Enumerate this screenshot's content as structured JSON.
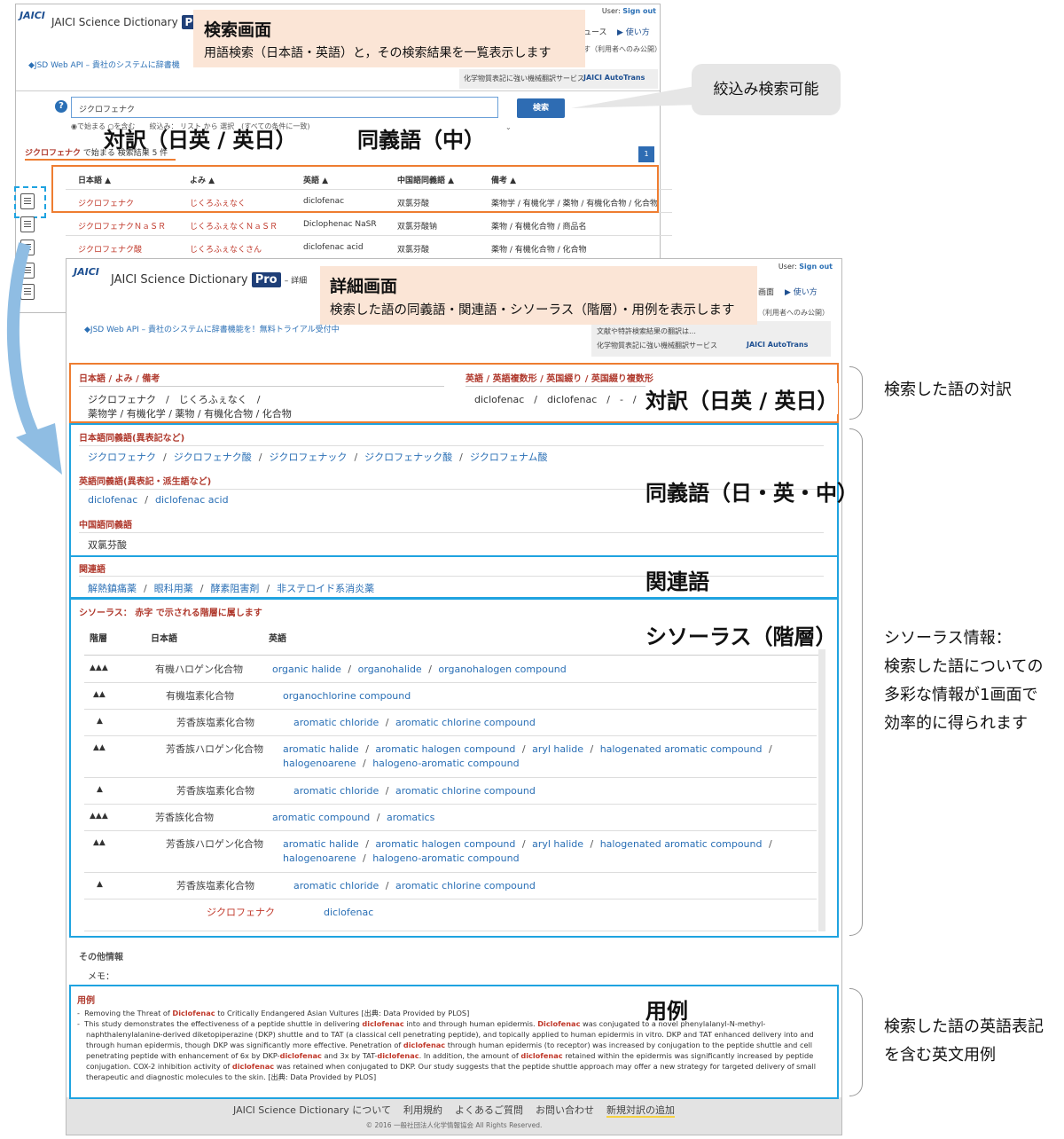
{
  "search": {
    "logo": "JAICI",
    "app_title": "JAICI Science Dictionary",
    "pro": "Pro",
    "user_label": "User:",
    "sign_out": "Sign out",
    "nav_news": "ュース",
    "nav_howto": "▶ 使い方",
    "nav_public": "す（利用者へのみ公開）",
    "api_link": "◆JSD Web API – 貴社のシステムに辞書機",
    "autotrans_text": "化学物質表記に強い機械翻訳サービス",
    "autotrans_brand": "JAICI AutoTrans",
    "help": "?",
    "query": "ジクロフェナク",
    "search_button": "検索",
    "options": "◉で始まる ○を含む　　絞込み： リスト から 選択　(すべての条件に一致)",
    "result_query": "ジクロフェナク",
    "result_text": " で始まる 検索結果 5 件",
    "page": "1",
    "columns": [
      "日本語 ▲",
      "よみ ▲",
      "英語 ▲",
      "中国語同義語 ▲",
      "備考 ▲"
    ],
    "rows": [
      [
        "ジクロフェナク",
        "じくろふぇなく",
        "diclofenac",
        "双氯芬酸",
        "薬物学 / 有機化学 / 薬物 / 有機化合物 / 化合物"
      ],
      [
        "ジクロフェナクＮａＳＲ",
        "じくろふぇなくＮａＳＲ",
        "Diclophenac NaSR",
        "双氯芬酸钠",
        "薬物 / 有機化合物 / 商品名"
      ],
      [
        "ジクロフェナク酸",
        "じくろふぇなくさん",
        "diclofenac acid",
        "双氯芬酸",
        "薬物 / 有機化合物 / 化合物"
      ]
    ]
  },
  "callouts": {
    "search_title": "検索画面",
    "search_desc": "用語検索（日本語・英語）と，その検索結果を一覧表示します",
    "narrow": "絞込み検索可能",
    "trans_label": "対訳（日英 / 英日）",
    "syn_mid_label": "同義語（中）",
    "detail_title": "詳細画面",
    "detail_desc": "検索した語の同義語・関連語・シソーラス（階層）・用例を表示します",
    "trans_label2": "対訳（日英 / 英日）",
    "syn_label": "同義語（日・英・中）",
    "rel_label": "関連語",
    "thes_label": "シソーラス（階層）",
    "ex_label": "用例"
  },
  "annotations": {
    "trans": "検索した語の対訳",
    "thes_lines": [
      "シソーラス情報：",
      "検索した語についての",
      "多彩な情報が1画面で",
      "効率的に得られます"
    ],
    "ex_lines": [
      "検索した語の英語表記",
      "を含む英文用例"
    ]
  },
  "detail": {
    "logo": "JAICI",
    "app_title": "JAICI Science Dictionary",
    "pro": "Pro",
    "crumb": "– 詳細",
    "user_label": "User:",
    "sign_out": "Sign out",
    "nav_screen": "画面",
    "nav_howto": "▶ 使い方",
    "nav_public": "（利用者へのみ公開）",
    "api_link": "◆JSD Web API – 貴社のシステムに辞書機能を！無料トライアル受付中",
    "promo_line1": "文献や特許検索結果の翻訳は…",
    "promo_line2": "化学物質表記に強い機械翻訳サービス",
    "autotrans_brand": "JAICI AutoTrans",
    "trans_ja_head": "日本語 / よみ / 備考",
    "trans_en_head": "英語 / 英語複数形 / 英国綴り / 英国綴り複数形",
    "trans_ja_line1": "ジクロフェナク　/　じくろふぇなく　/",
    "trans_ja_line2": "薬物学 / 有機化学 / 薬物 / 有機化合物 / 化合物",
    "trans_en_line": "diclofenac　/　diclofenac　/　-　/　-",
    "jp_syn_head": "日本語同義語(異表記など)",
    "jp_syn": [
      "ジクロフェナク",
      "ジクロフェナク酸",
      "ジクロフェナック",
      "ジクロフェナック酸",
      "ジクロフェナム酸"
    ],
    "en_syn_head": "英語同義語(異表記・派生語など)",
    "en_syn": [
      "diclofenac",
      "diclofenac acid"
    ],
    "cn_syn_head": "中国語同義語",
    "cn_syn": [
      "双氯芬酸"
    ],
    "rel_head": "関連語",
    "related": [
      "解熱鎮痛薬",
      "眼科用薬",
      "酵素阻害剤",
      "非ステロイド系消炎薬"
    ],
    "thes_head": "シソーラス：",
    "thes_head_red": "赤字",
    "thes_head_rest": "で示される階層に属します",
    "thes_col_level": "階層",
    "thes_col_ja": "日本語",
    "thes_col_en": "英語",
    "thes_rows": [
      {
        "level": "▲▲▲",
        "ja": "有機ハロゲン化合物",
        "en": [
          "organic halide",
          "organohalide",
          "organohalogen compound"
        ]
      },
      {
        "level": "▲▲",
        "ja": "有機塩素化合物",
        "en": [
          "organochlorine compound"
        ]
      },
      {
        "level": "▲",
        "ja": "芳香族塩素化合物",
        "en": [
          "aromatic chloride",
          "aromatic chlorine compound"
        ]
      },
      {
        "level": "▲▲",
        "ja": "芳香族ハロゲン化合物",
        "en": [
          "aromatic halide",
          "aromatic halogen compound",
          "aryl halide",
          "halogenated aromatic compound",
          "halogenoarene",
          "halogeno-aromatic compound"
        ]
      },
      {
        "level": "▲",
        "ja": "芳香族塩素化合物",
        "en": [
          "aromatic chloride",
          "aromatic chlorine compound"
        ]
      },
      {
        "level": "▲▲▲",
        "ja": "芳香族化合物",
        "en": [
          "aromatic compound",
          "aromatics"
        ]
      },
      {
        "level": "▲▲",
        "ja": "芳香族ハロゲン化合物",
        "en": [
          "aromatic halide",
          "aromatic halogen compound",
          "aryl halide",
          "halogenated aromatic compound",
          "halogenoarene",
          "halogeno-aromatic compound"
        ]
      },
      {
        "level": "▲",
        "ja": "芳香族塩素化合物",
        "en": [
          "aromatic chloride",
          "aromatic chlorine compound"
        ]
      },
      {
        "level": "",
        "ja": "ジクロフェナク",
        "en": [
          "diclofenac"
        ]
      }
    ],
    "other_head": "その他情報",
    "memo": "メモ：",
    "ex_head": "用例",
    "example1": "Removing the Threat of Diclofenac to Critically Endangered Asian Vultures [出典: Data Provided by PLOS]",
    "example2": "This study demonstrates the effectiveness of a peptide shuttle in delivering diclofenac into and through human epidermis. Diclofenac was conjugated to a novel phenylalanyl-N-methyl-naphthalenylalanine-derived diketopiperazine (DKP) shuttle and to TAT (a classical cell penetrating peptide), and topically applied to human epidermis in vitro. DKP and TAT enhanced delivery into and through human epidermis, though DKP was significantly more effective. Penetration of diclofenac through human epidermis (to receptor) was increased by conjugation to the peptide shuttle and cell penetrating peptide with enhancement of 6x by DKP-diclofenac and 3x by TAT-diclofenac. In addition, the amount of diclofenac retained within the epidermis was significantly increased by peptide conjugation. COX-2 inhibition activity of diclofenac was retained when conjugated to DKP. Our study suggests that the peptide shuttle approach may offer a new strategy for targeted delivery of small therapeutic and diagnostic molecules to the skin. [出典: Data Provided by PLOS]",
    "footer_links": [
      "JAICI Science Dictionary について",
      "利用規約",
      "よくあるご質問",
      "お問い合わせ",
      "新規対訳の追加"
    ],
    "copyright": "© 2016 一般社団法人化学情報協会 All Rights Reserved."
  },
  "colors": {
    "orange": "#ee7d31",
    "cyan": "#1fa3e0",
    "peach": "#fbe5d6",
    "link": "#2a6fb5",
    "heading_red": "#b03a2e"
  }
}
